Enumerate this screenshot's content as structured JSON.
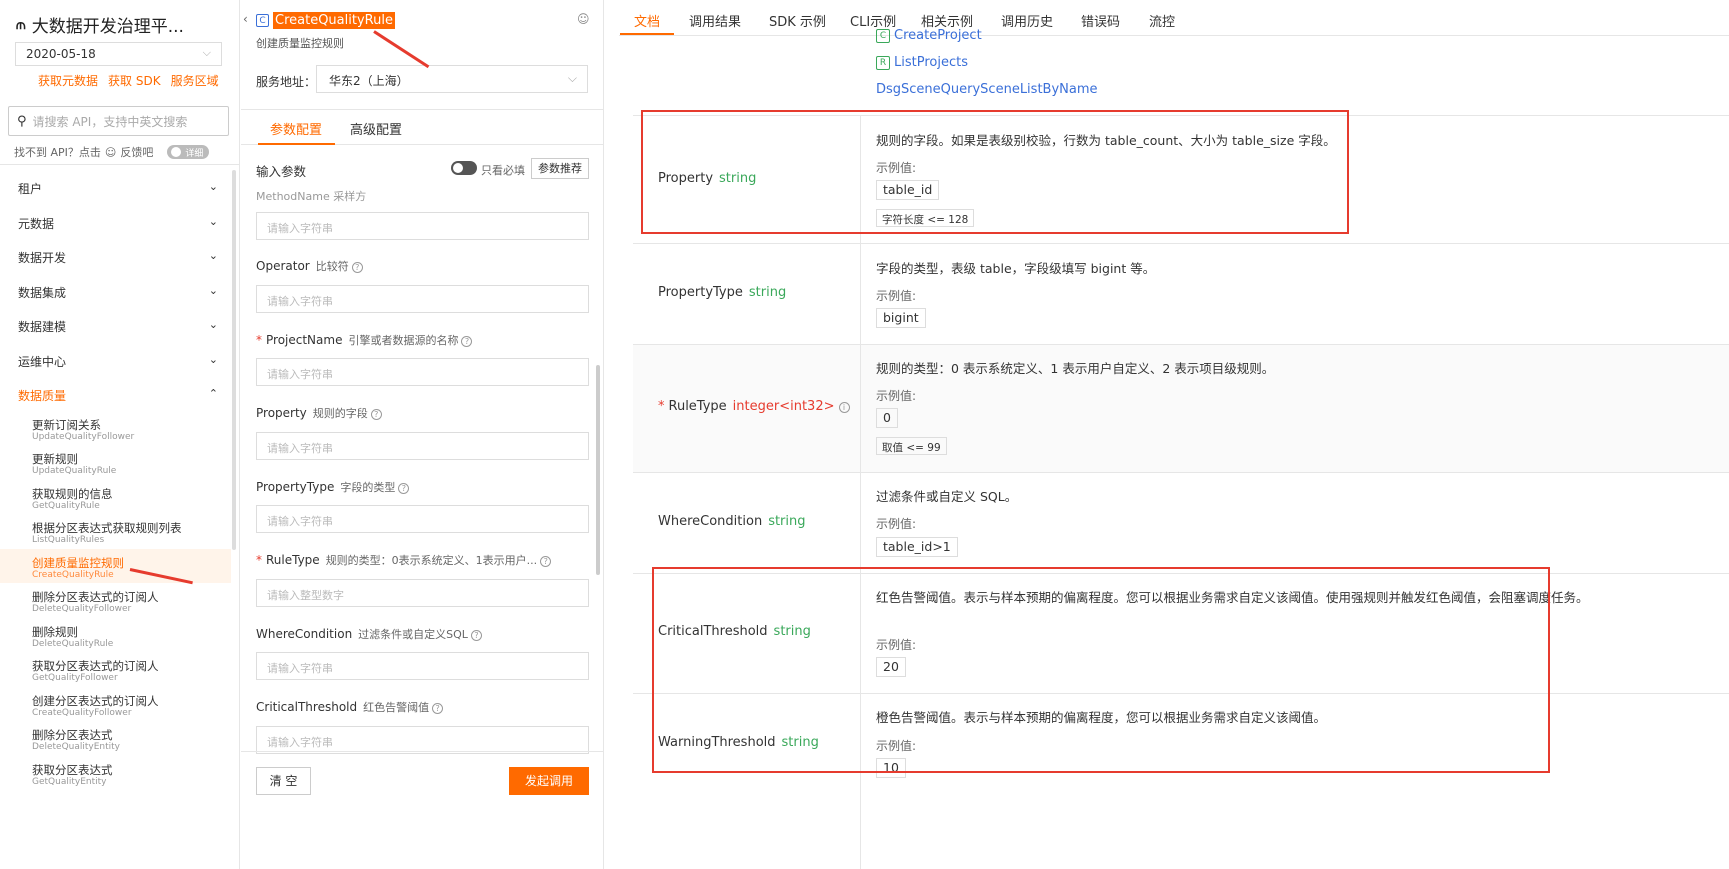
{
  "left": {
    "app_title": "大数据开发治理平...",
    "date": "2020-05-18",
    "links": [
      "获取元数据",
      "获取 SDK",
      "服务区域"
    ],
    "search_placeholder": "请搜索 API，支持中英文搜索",
    "feedback_text": "找不到 API？点击",
    "feedback_link": "反馈吧",
    "detail_toggle": "详细",
    "categories": [
      "租户",
      "元数据",
      "数据开发",
      "数据集成",
      "数据建模",
      "运维中心",
      "数据质量"
    ],
    "items": [
      {
        "label": "更新订阅关系",
        "api": "UpdateQualityFollower"
      },
      {
        "label": "更新规则",
        "api": "UpdateQualityRule"
      },
      {
        "label": "获取规则的信息",
        "api": "GetQualityRule"
      },
      {
        "label": "根据分区表达式获取规则列表",
        "api": "ListQualityRules"
      },
      {
        "label": "创建质量监控规则",
        "api": "CreateQualityRule"
      },
      {
        "label": "删除分区表达式的订阅人",
        "api": "DeleteQualityFollower"
      },
      {
        "label": "删除规则",
        "api": "DeleteQualityRule"
      },
      {
        "label": "获取分区表达式的订阅人",
        "api": "GetQualityFollower"
      },
      {
        "label": "创建分区表达式的订阅人",
        "api": "CreateQualityFollower"
      },
      {
        "label": "删除分区表达式",
        "api": "DeleteQualityEntity"
      },
      {
        "label": "获取分区表达式",
        "api": "GetQualityEntity"
      }
    ]
  },
  "mid": {
    "api_name": "CreateQualityRule",
    "api_icon": "C",
    "desc": "创建质量监控规则",
    "addr_label": "服务地址：",
    "addr_value": "华东2（上海）",
    "tabs": [
      "参数配置",
      "高级配置"
    ],
    "input_params": "输入参数",
    "only_required": "只看必填",
    "recommend": "参数推荐",
    "partial_label": "MethodName  采样方",
    "params": [
      {
        "name": "Operator",
        "desc": "比较符",
        "required": false,
        "placeholder": "请输入字符串"
      },
      {
        "name": "ProjectName",
        "desc": "引擎或者数据源的名称",
        "required": true,
        "placeholder": "请输入字符串"
      },
      {
        "name": "Property",
        "desc": "规则的字段",
        "required": false,
        "placeholder": "请输入字符串"
      },
      {
        "name": "PropertyType",
        "desc": "字段的类型",
        "required": false,
        "placeholder": "请输入字符串"
      },
      {
        "name": "RuleType",
        "desc": "规则的类型：0表示系统定义、1表示用户...",
        "required": true,
        "placeholder": "请输入整型数字"
      },
      {
        "name": "WhereCondition",
        "desc": "过滤条件或自定义SQL",
        "required": false,
        "placeholder": "请输入字符串"
      },
      {
        "name": "CriticalThreshold",
        "desc": "红色告警阈值",
        "required": false,
        "placeholder": "请输入字符串"
      }
    ],
    "first_placeholder": "请输入字符串",
    "clear": "清 空",
    "send": "发起调用"
  },
  "right": {
    "tabs": [
      "文档",
      "调用结果",
      "SDK 示例",
      "CLI示例",
      "相关示例",
      "调用历史",
      "错误码",
      "流控"
    ],
    "related_links": [
      "CreateProject",
      "ListProjects",
      "DsgSceneQuerySceneListByName"
    ],
    "example_label": "示例值:",
    "rows": [
      {
        "name": "Property",
        "type": "string",
        "required": false,
        "desc": "规则的字段。如果是表级别校验，行数为 table_count、大小为 table_size 字段。",
        "example": "table_id",
        "constraint": "字符长度 <= 128"
      },
      {
        "name": "PropertyType",
        "type": "string",
        "required": false,
        "desc": "字段的类型，表级 table，字段级填写 bigint 等。",
        "example": "bigint",
        "constraint": ""
      },
      {
        "name": "RuleType",
        "type": "integer<int32>",
        "required": true,
        "desc": "规则的类型：0 表示系统定义、1 表示用户自定义、2 表示项目级规则。",
        "example": "0",
        "constraint": "取值 <= 99"
      },
      {
        "name": "WhereCondition",
        "type": "string",
        "required": false,
        "desc": "过滤条件或自定义 SQL。",
        "example": "table_id>1",
        "constraint": ""
      },
      {
        "name": "CriticalThreshold",
        "type": "string",
        "required": false,
        "desc": "红色告警阈值。表示与样本预期的偏离程度。您可以根据业务需求自定义该阈值。使用强规则并触发红色阈值，会阻塞调度任务。",
        "example": "20",
        "constraint": ""
      },
      {
        "name": "WarningThreshold",
        "type": "string",
        "required": false,
        "desc": "橙色告警阈值。表示与样本预期的偏离程度，您可以根据业务需求自定义该阈值。",
        "example": "10",
        "constraint": ""
      }
    ]
  },
  "colors": {
    "accent": "#ff6a00",
    "highlight": "#e63b2e",
    "link": "#3a6fd8",
    "type": "#3aa85a"
  }
}
